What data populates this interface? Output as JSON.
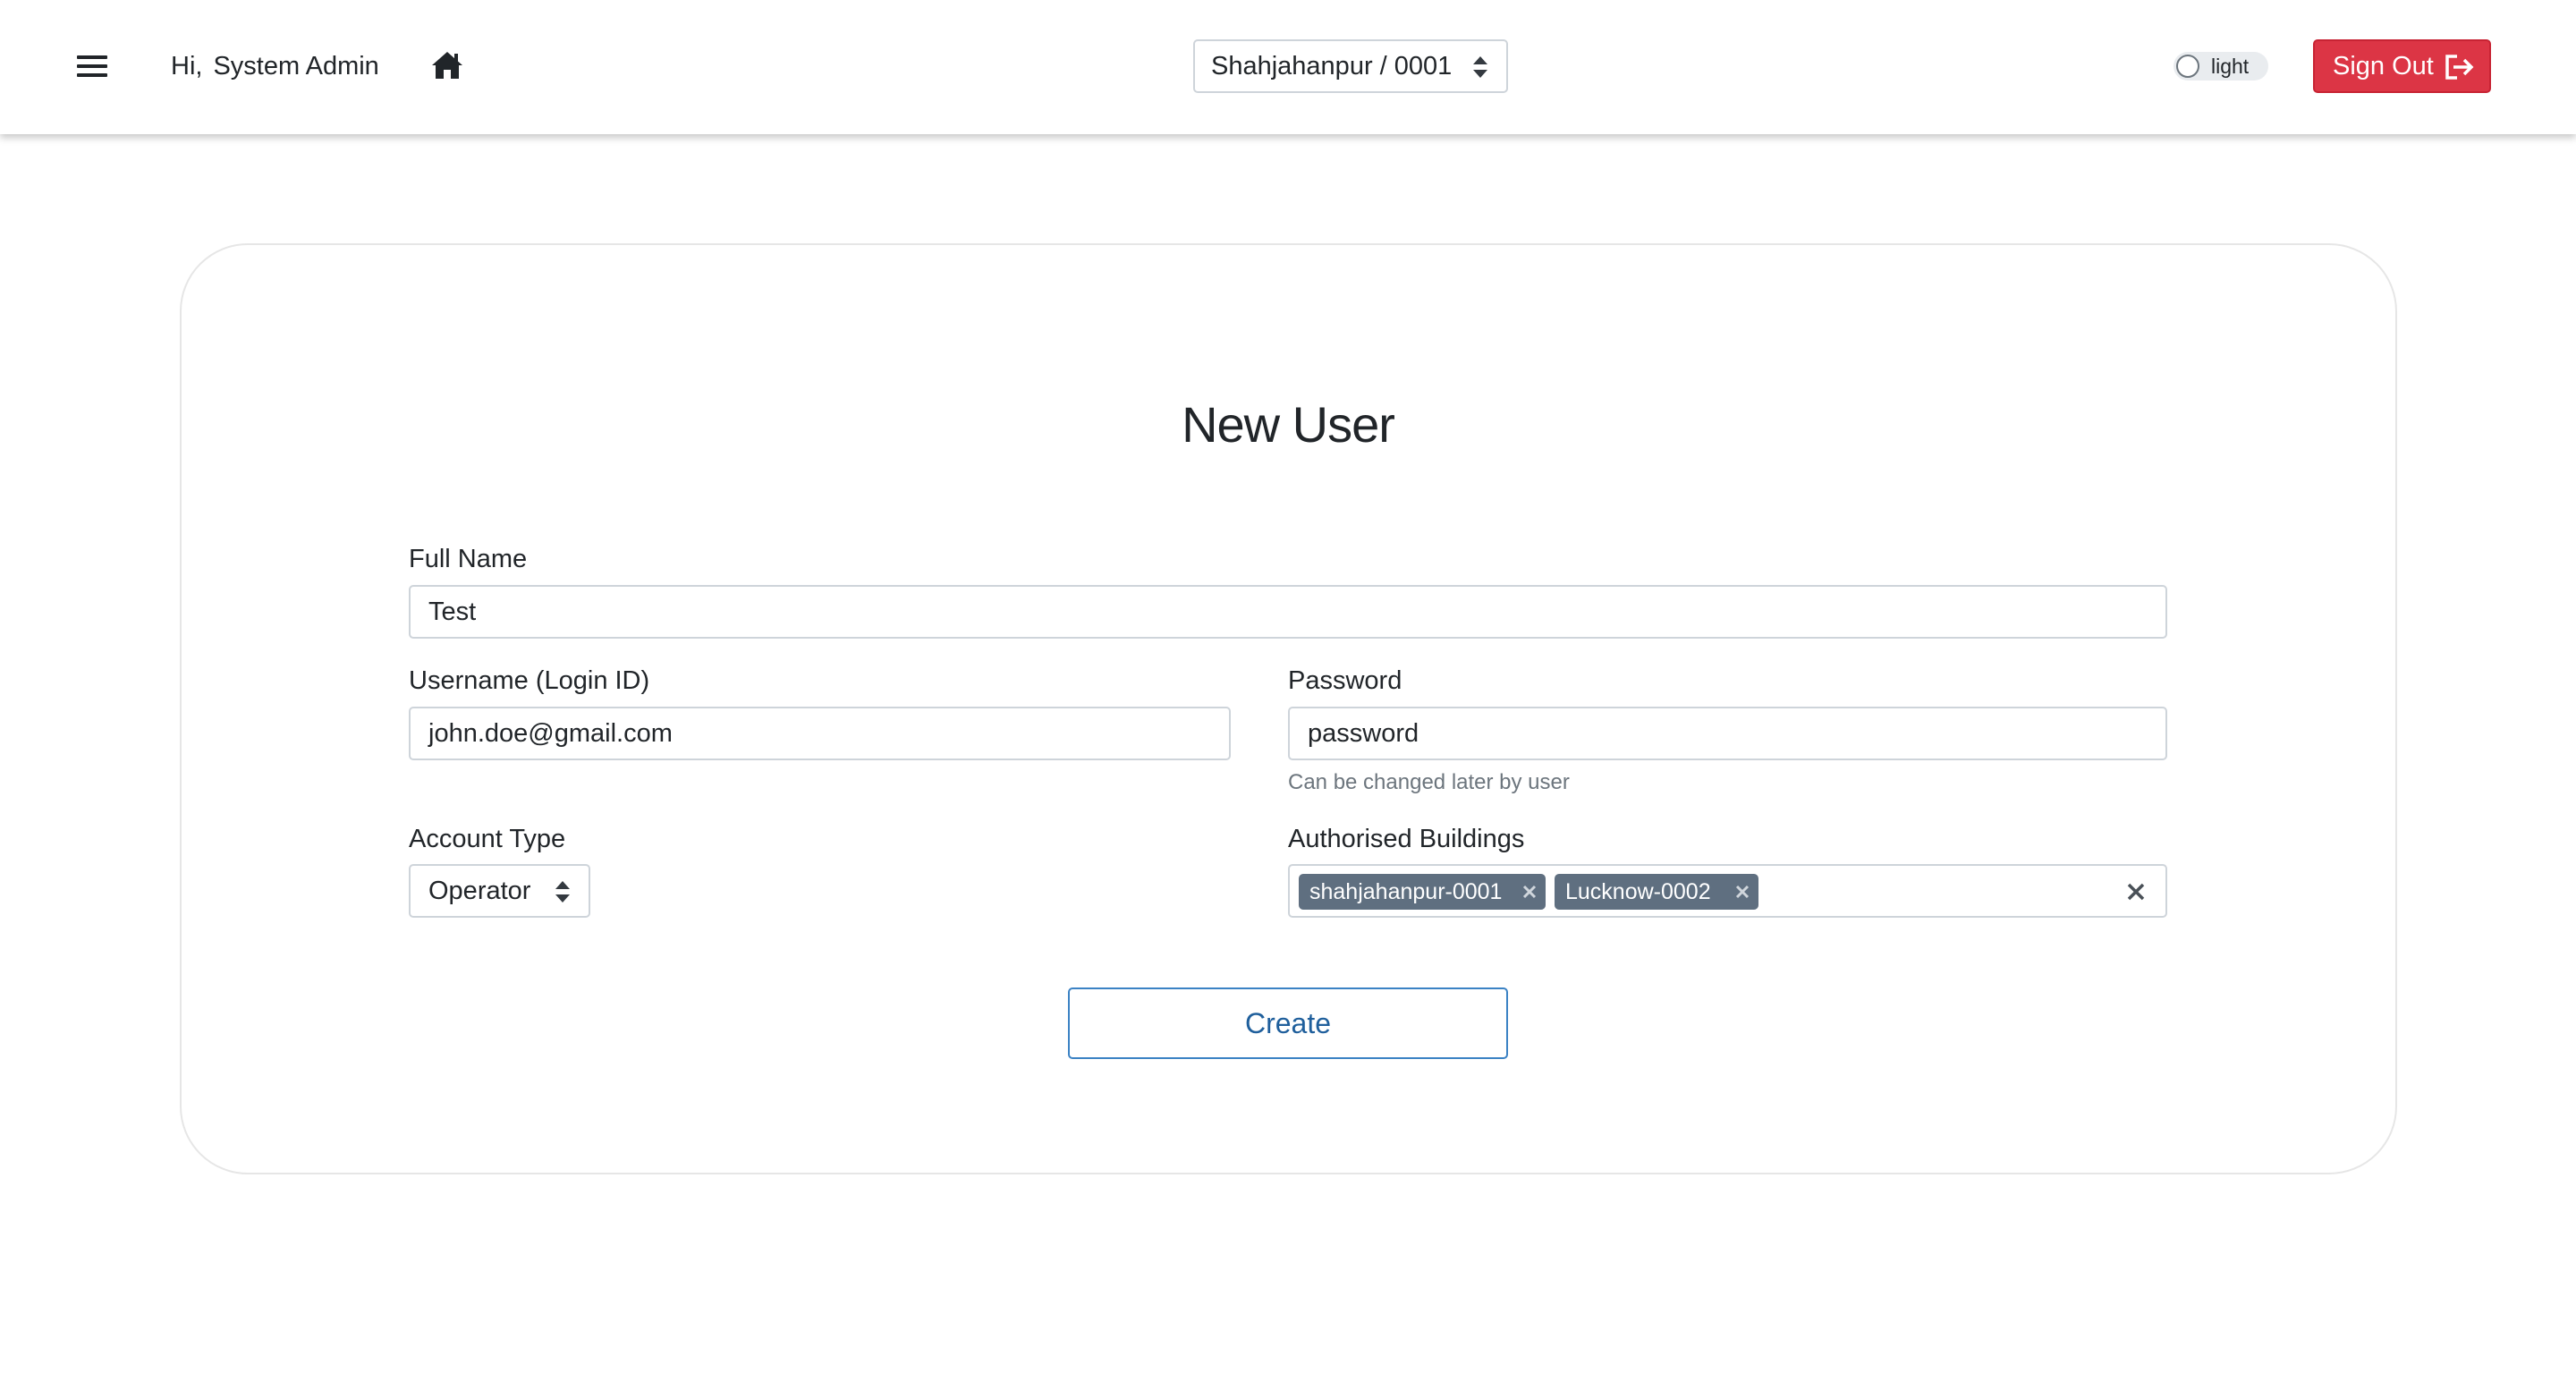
{
  "navbar": {
    "greeting": "Hi,",
    "user_name": "System Admin",
    "site_selector": "Shahjahanpur / 0001",
    "theme_toggle_label": "light",
    "sign_out_label": "Sign Out"
  },
  "form": {
    "title": "New User",
    "full_name": {
      "label": "Full Name",
      "value": "Test"
    },
    "username": {
      "label": "Username (Login ID)",
      "value": "john.doe@gmail.com"
    },
    "password": {
      "label": "Password",
      "value": "password",
      "help": "Can be changed later by user"
    },
    "account_type": {
      "label": "Account Type",
      "value": "Operator"
    },
    "buildings": {
      "label": "Authorised Buildings",
      "selected": [
        "shahjahanpur-0001",
        "Lucknow-0002"
      ]
    },
    "submit_label": "Create"
  },
  "colors": {
    "danger": "#dc3545",
    "chip": "#5f6f80",
    "primary_outline": "#3b82c4"
  }
}
